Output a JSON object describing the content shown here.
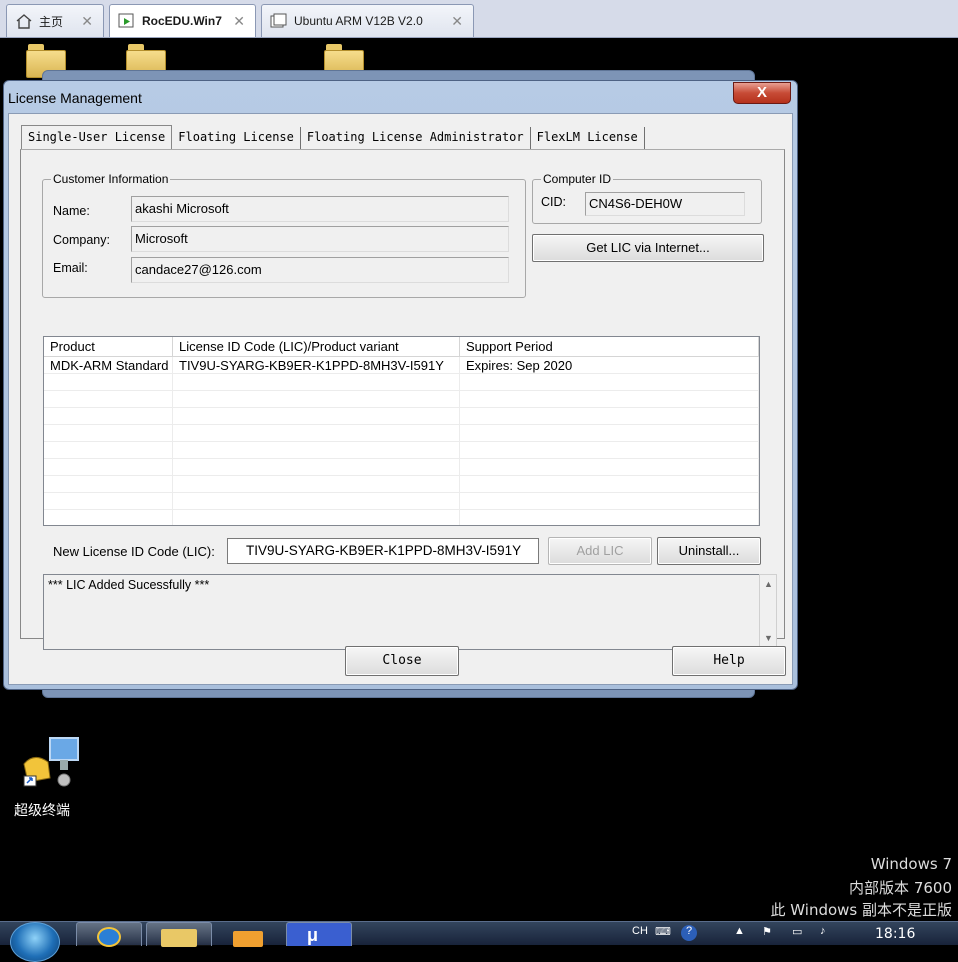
{
  "vmware_tabs": [
    {
      "label": "主页",
      "icon": "home-icon"
    },
    {
      "label": "RocEDU.Win7",
      "icon": "vm-running-icon"
    },
    {
      "label": "Ubuntu ARM V12B V2.0",
      "icon": "vm-icon"
    }
  ],
  "dialog": {
    "title": "License Management",
    "close_glyph": "X",
    "tabs": [
      "Single-User License",
      "Floating License",
      "Floating License Administrator",
      "FlexLM License"
    ],
    "customer": {
      "legend": "Customer Information",
      "name_label": "Name:",
      "name_value": "akashi Microsoft",
      "company_label": "Company:",
      "company_value": "Microsoft",
      "email_label": "Email:",
      "email_value": "candace27@126.com"
    },
    "computer": {
      "legend": "Computer ID",
      "cid_label": "CID:",
      "cid_value": "CN4S6-DEH0W",
      "get_lic_button": "Get LIC via Internet..."
    },
    "list": {
      "columns": [
        "Product",
        "License ID Code (LIC)/Product variant",
        "Support Period"
      ],
      "rows": [
        [
          "MDK-ARM Standard",
          "TIV9U-SYARG-KB9ER-K1PPD-8MH3V-I591Y",
          "Expires: Sep 2020"
        ]
      ]
    },
    "new_lic_label": "New License ID Code (LIC):",
    "new_lic_value": "TIV9U-SYARG-KB9ER-K1PPD-8MH3V-I591Y",
    "add_lic_button": "Add LIC",
    "uninstall_button": "Uninstall...",
    "log_text": "*** LIC Added Sucessfully ***",
    "close_button": "Close",
    "help_button": "Help"
  },
  "desktop": {
    "icon_label": "超级终端",
    "watermark": [
      "Windows 7",
      "内部版本 7600",
      "此 Windows 副本不是正版"
    ]
  },
  "taskbar": {
    "tray_lang": "CH",
    "clock": "18:16"
  }
}
